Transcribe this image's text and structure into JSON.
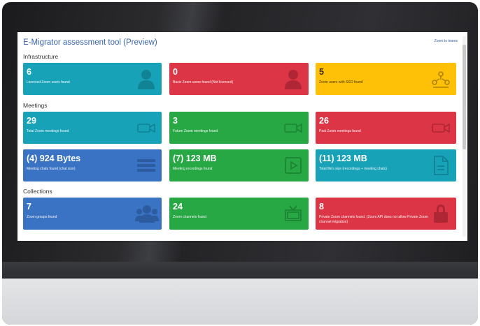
{
  "app": {
    "title": "E-Migrator assessment tool (Preview)",
    "top_link": "Zoom to teams"
  },
  "sections": {
    "infrastructure": "Infrastructure",
    "meetings": "Meetings",
    "collections": "Collections"
  },
  "cards": {
    "licensed_users": {
      "value": "6",
      "label": "Licensed Zoom users found",
      "color": "#17a2b8",
      "icon": "user-icon"
    },
    "basic_users": {
      "value": "0",
      "label": "Basic Zoom users found (Not licensed)",
      "color": "#dc3545",
      "icon": "user-icon"
    },
    "sso_users": {
      "value": "5",
      "label": "Zoom users with SSO found",
      "color": "#ffc107",
      "icon": "network-icon"
    },
    "total_meetings": {
      "value": "29",
      "label": "Total Zoom meetings found",
      "color": "#17a2b8",
      "icon": "video-camera-icon"
    },
    "future_meetings": {
      "value": "3",
      "label": "Future Zoom meetings found",
      "color": "#28a745",
      "icon": "video-camera-icon"
    },
    "past_meetings": {
      "value": "26",
      "label": "Past Zoom meetings found",
      "color": "#dc3545",
      "icon": "video-camera-icon"
    },
    "meeting_chats": {
      "value": "(4) 924 Bytes",
      "label": "Meeting chats found (chat size)",
      "color": "#3a73c4",
      "icon": "chat-lines-icon"
    },
    "meeting_recordings": {
      "value": "(7) 123 MB",
      "label": "Meeting recordings found",
      "color": "#28a745",
      "icon": "play-icon"
    },
    "total_files": {
      "value": "(11) 123 MB",
      "label": "Total file's size (recordings + meeting chats)",
      "color": "#17a2b8",
      "icon": "file-icon"
    },
    "zoom_groups": {
      "value": "7",
      "label": "Zoom groups found",
      "color": "#3a73c4",
      "icon": "users-icon"
    },
    "zoom_channels": {
      "value": "24",
      "label": "Zoom channels found",
      "color": "#28a745",
      "icon": "tv-icon"
    },
    "private_channels": {
      "value": "8",
      "label": "Private Zoom channels found. (Zoom API does not allow Private Zoom channel migration)",
      "color": "#dc3545",
      "icon": "lock-icon"
    }
  }
}
